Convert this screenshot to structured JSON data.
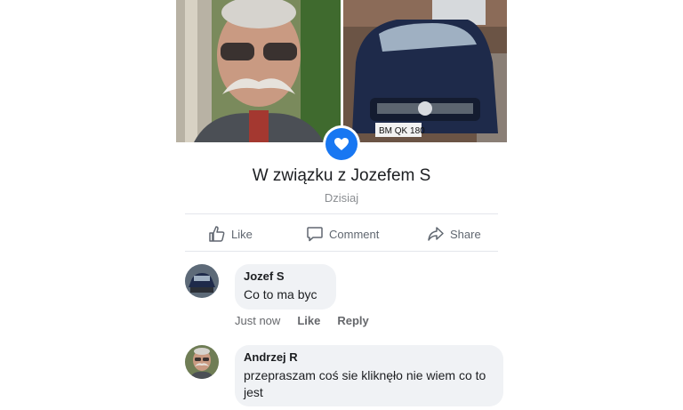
{
  "post": {
    "event_title": "W związku z Jozefem S",
    "event_date": "Dzisiaj",
    "badge_icon": "heart-icon",
    "accent_color": "#1877f2",
    "right_photo_plate_text": "BM QK 180"
  },
  "actions": {
    "like_label": "Like",
    "comment_label": "Comment",
    "share_label": "Share"
  },
  "comments": [
    {
      "author": "Jozef S",
      "text": "Co to ma byc",
      "time": "Just now",
      "like_label": "Like",
      "reply_label": "Reply"
    },
    {
      "author": "Andrzej R",
      "text": "przepraszam coś sie kliknęło nie wiem co to jest"
    }
  ]
}
